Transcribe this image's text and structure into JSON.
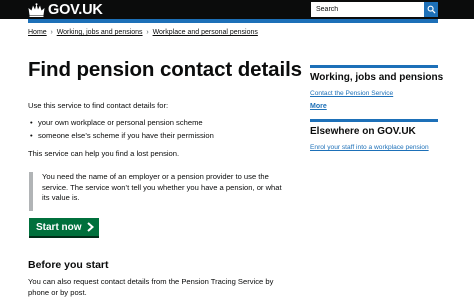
{
  "header": {
    "logo_text": "GOV.UK",
    "search_placeholder": "Search"
  },
  "breadcrumb": [
    "Home",
    "Working, jobs and pensions",
    "Workplace and personal pensions"
  ],
  "main": {
    "title": "Find pension contact details",
    "intro": "Use this service to find contact details for:",
    "bullets": [
      "your own workplace or personal pension scheme",
      "someone else’s scheme if you have their permission"
    ],
    "lost_pension": "This service can help you find a lost pension.",
    "inset_lines": [
      "You need the name of an employer or a pension provider to use the",
      "service. The service won’t tell you whether you have a pension, or what",
      "its value is."
    ],
    "start_button": "Start now",
    "before_heading": "Before you start",
    "before_lines": [
      "You can also request contact details from the Pension Tracing Service by",
      "phone or by post."
    ]
  },
  "sidebar": {
    "section1_heading": "Working, jobs and pensions",
    "section1_link": "Contact the Pension Service",
    "section1_more": "More",
    "section2_heading": "Elsewhere on GOV.UK",
    "section2_link": "Enrol your staff into a workplace pension"
  },
  "colors": {
    "header_bg": "#0b0c0c",
    "brand_blue": "#1d70b8",
    "button_green": "#00703c",
    "inset_border": "#b1b4b6"
  },
  "icons": [
    "crown-icon",
    "search-icon",
    "arrow-right-icon"
  ]
}
